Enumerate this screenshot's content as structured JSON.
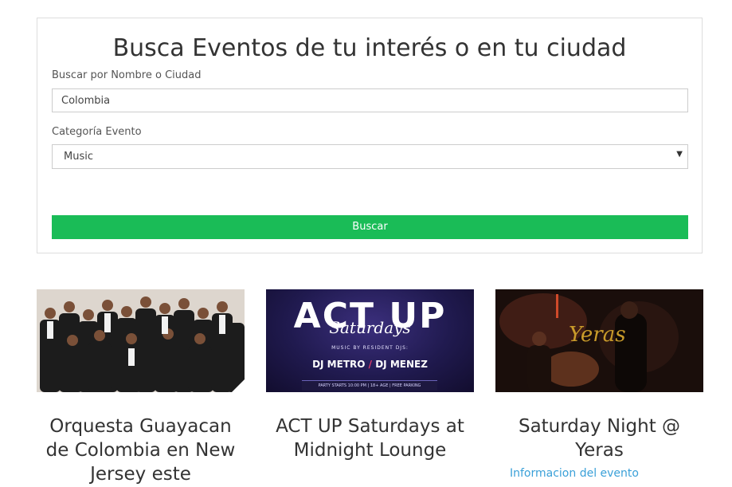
{
  "search": {
    "title": "Busca Eventos de tu interés o en tu ciudad",
    "name_label": "Buscar por Nombre o Ciudad",
    "name_value": "Colombia",
    "category_label": "Categoría Evento",
    "category_value": "Music",
    "button_label": "Buscar",
    "button_color": "#1abc57"
  },
  "events": [
    {
      "title": "Orquesta Guayacan de Colombia en New Jersey este",
      "image_icon": "band-photo"
    },
    {
      "title": "ACT UP Saturdays at Midnight Lounge",
      "image_icon": "poster",
      "poster": {
        "headline": "ACT UP",
        "script": "Saturdays",
        "music_line": "MUSIC BY RESIDENT DJS:",
        "dj_1": "DJ METRO",
        "dj_sep": "/",
        "dj_2": "DJ MENEZ",
        "footer": "PARTY STARTS 10:00 PM | 18+ AGE | FREE PARKING"
      }
    },
    {
      "title": "Saturday Night @ Yeras",
      "image_icon": "night-photo",
      "logo_text": "Yeras",
      "link_label": "Informacion del evento"
    }
  ]
}
